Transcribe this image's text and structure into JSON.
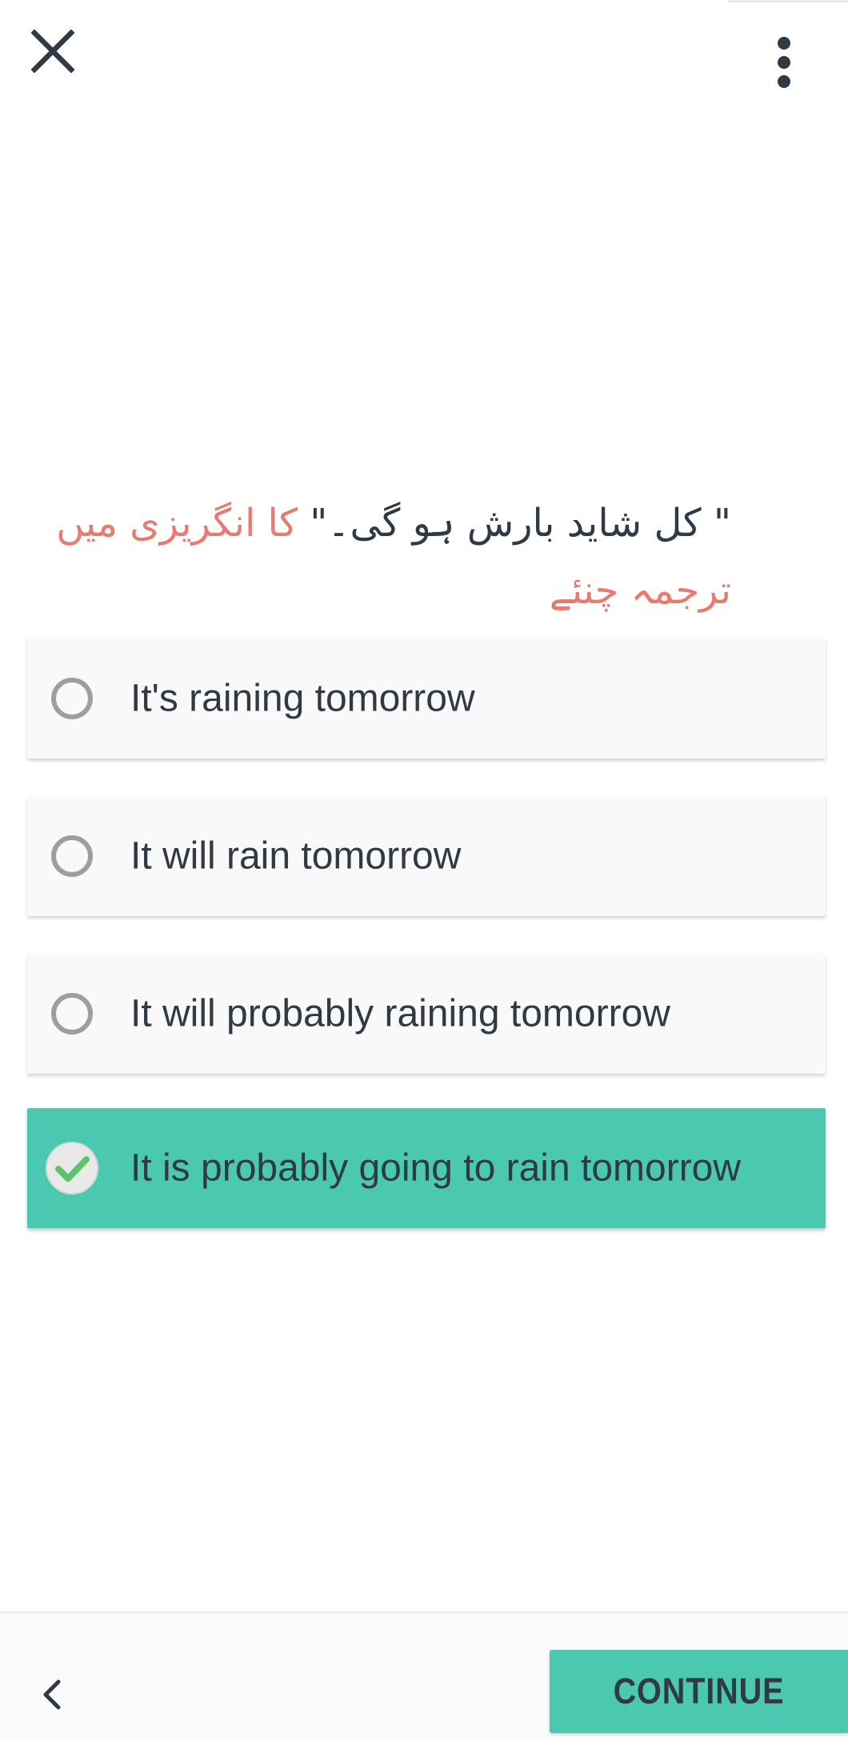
{
  "header": {
    "close_icon": "close-icon",
    "more_icon": "more-vert-icon"
  },
  "question": {
    "quote_text": "\" کل شاید بارش ہو گی۔\"",
    "instruction": " کا انگریزی میں ترجمہ چنئے",
    "quote_color": "#2f3a44",
    "instruction_color": "#e87a70"
  },
  "options": [
    {
      "label": "It's raining tomorrow",
      "selected": false
    },
    {
      "label": "It will rain tomorrow",
      "selected": false
    },
    {
      "label": "It will probably raining tomorrow",
      "selected": false
    },
    {
      "label": "It is probably going to rain tomorrow",
      "selected": true
    }
  ],
  "footer": {
    "back_icon": "chevron-left-icon",
    "continue_label": "CONTINUE"
  },
  "colors": {
    "accent": "#4ac9b0",
    "text": "#2f3a44",
    "radio": "#9e9e9e",
    "check": "#5cc46b"
  }
}
